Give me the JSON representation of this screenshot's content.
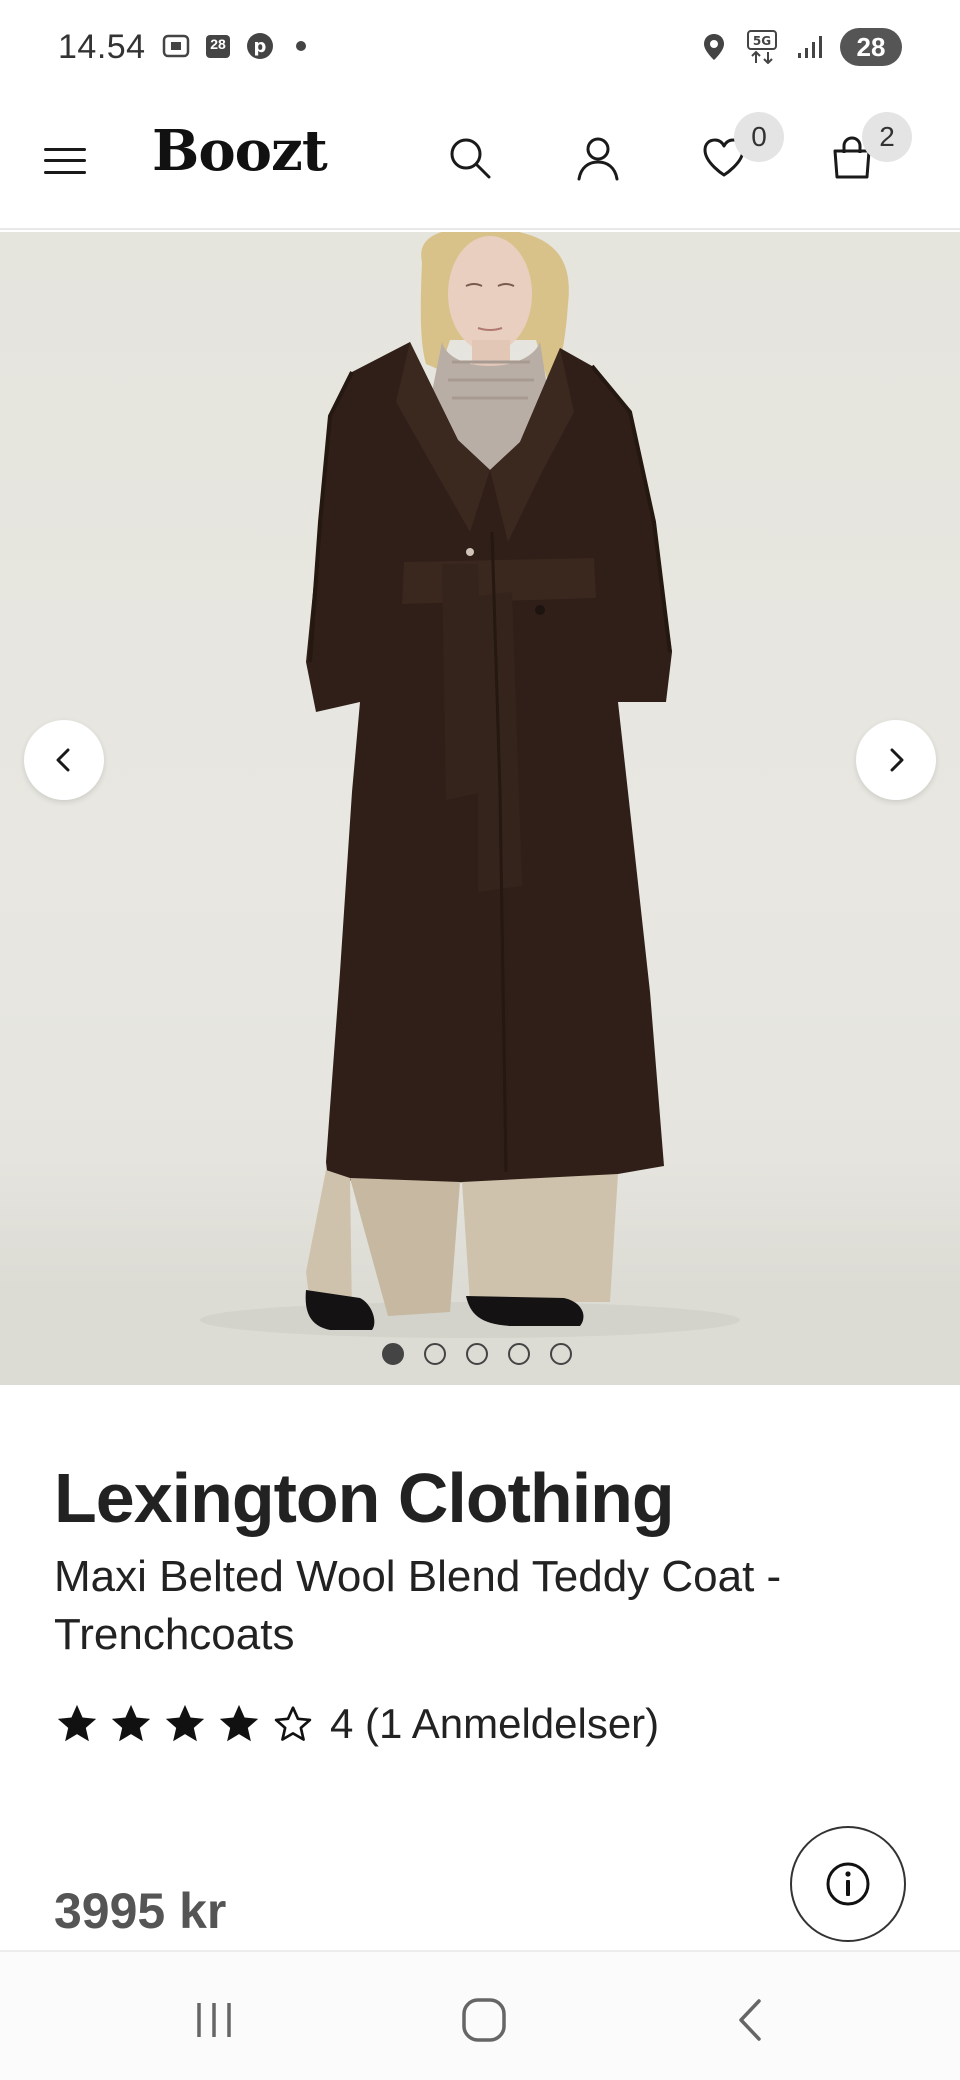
{
  "status_bar": {
    "time": "14.54",
    "calendar_day": "28",
    "battery": "28",
    "network": "5G",
    "icons_left": [
      "screenshot-icon",
      "calendar-icon",
      "pinterest-icon",
      "dot-icon"
    ],
    "icons_right": [
      "location-icon",
      "5g-icon",
      "signal-icon",
      "battery-icon"
    ]
  },
  "header": {
    "logo": "Boozt",
    "wishlist_count": "0",
    "cart_count": "2",
    "icons": [
      "menu-icon",
      "search-icon",
      "account-icon",
      "heart-icon",
      "bag-icon"
    ]
  },
  "gallery": {
    "image_count": 5,
    "active_index": 0,
    "prev_icon": "chevron-left-icon",
    "next_icon": "chevron-right-icon"
  },
  "product": {
    "brand": "Lexington Clothing",
    "name_line1": "Maxi Belted Wool Blend Teddy Coat -",
    "name_line2": "Trenchcoats",
    "rating_value": 4,
    "rating_max": 5,
    "rating_text": "4 (1 Anmeldelser)",
    "price": "3995 kr",
    "info_icon": "info-icon"
  },
  "navbar": {
    "icons": [
      "recents-icon",
      "home-icon",
      "back-icon"
    ]
  },
  "colors": {
    "coat": "#2f1f18",
    "trousers": "#cfc2ad",
    "background": "#e6e5de",
    "text": "#1a1a1a",
    "badge": "#e4e4e4"
  }
}
